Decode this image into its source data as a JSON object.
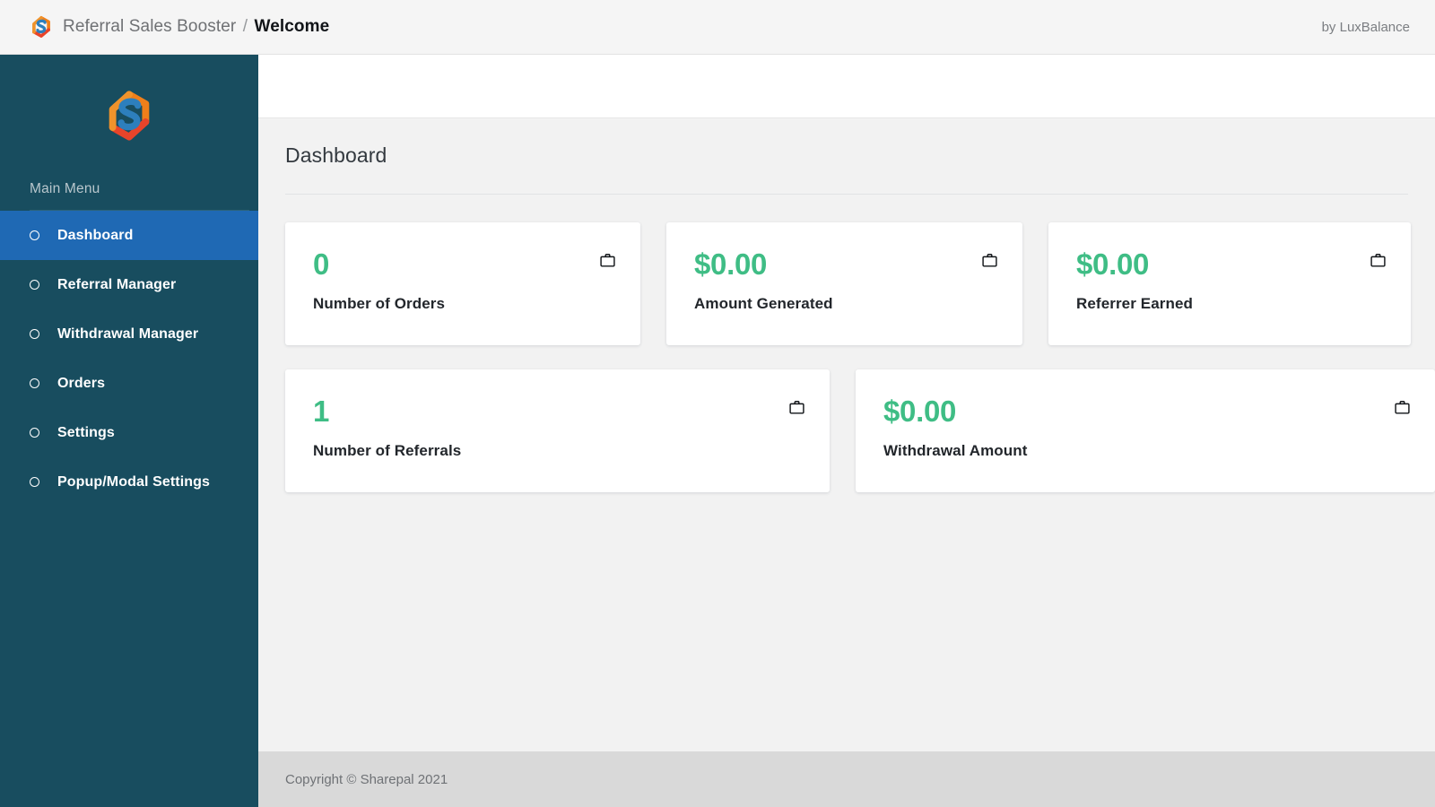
{
  "topbar": {
    "logo_icon": "sharepal-hex-s-logo",
    "app_name": "Referral Sales Booster",
    "separator": "/",
    "current_page": "Welcome",
    "credit": "by LuxBalance"
  },
  "sidebar": {
    "logo_icon": "sharepal-hex-s-logo",
    "menu_heading": "Main Menu",
    "items": [
      {
        "label": "Dashboard",
        "icon": "circle-bullet-icon",
        "active": true
      },
      {
        "label": "Referral Manager",
        "icon": "circle-bullet-icon",
        "active": false
      },
      {
        "label": "Withdrawal Manager",
        "icon": "circle-bullet-icon",
        "active": false
      },
      {
        "label": "Orders",
        "icon": "circle-bullet-icon",
        "active": false
      },
      {
        "label": "Settings",
        "icon": "circle-bullet-icon",
        "active": false
      },
      {
        "label": "Popup/Modal Settings",
        "icon": "circle-bullet-icon",
        "active": false
      }
    ]
  },
  "main": {
    "page_title": "Dashboard",
    "stat_rows": [
      [
        {
          "value": "0",
          "label": "Number of Orders",
          "icon": "briefcase-icon"
        },
        {
          "value": "$0.00",
          "label": "Amount Generated",
          "icon": "briefcase-icon"
        },
        {
          "value": "$0.00",
          "label": "Referrer Earned",
          "icon": "briefcase-icon"
        }
      ],
      [
        {
          "value": "1",
          "label": "Number of Referrals",
          "icon": "briefcase-icon"
        },
        {
          "value": "$0.00",
          "label": "Withdrawal Amount",
          "icon": "briefcase-icon"
        }
      ]
    ]
  },
  "footer": {
    "copyright": "Copyright © Sharepal 2021"
  },
  "colors": {
    "sidebar_bg": "#184d5f",
    "sidebar_active": "#1f69b4",
    "stat_value": "#3fbd85",
    "topbar_bg": "#f5f5f5",
    "content_bg": "#f2f2f2",
    "footer_bg": "#d9d9d9",
    "logo_orange": "#e8622a",
    "logo_blue": "#2d7fbd"
  }
}
